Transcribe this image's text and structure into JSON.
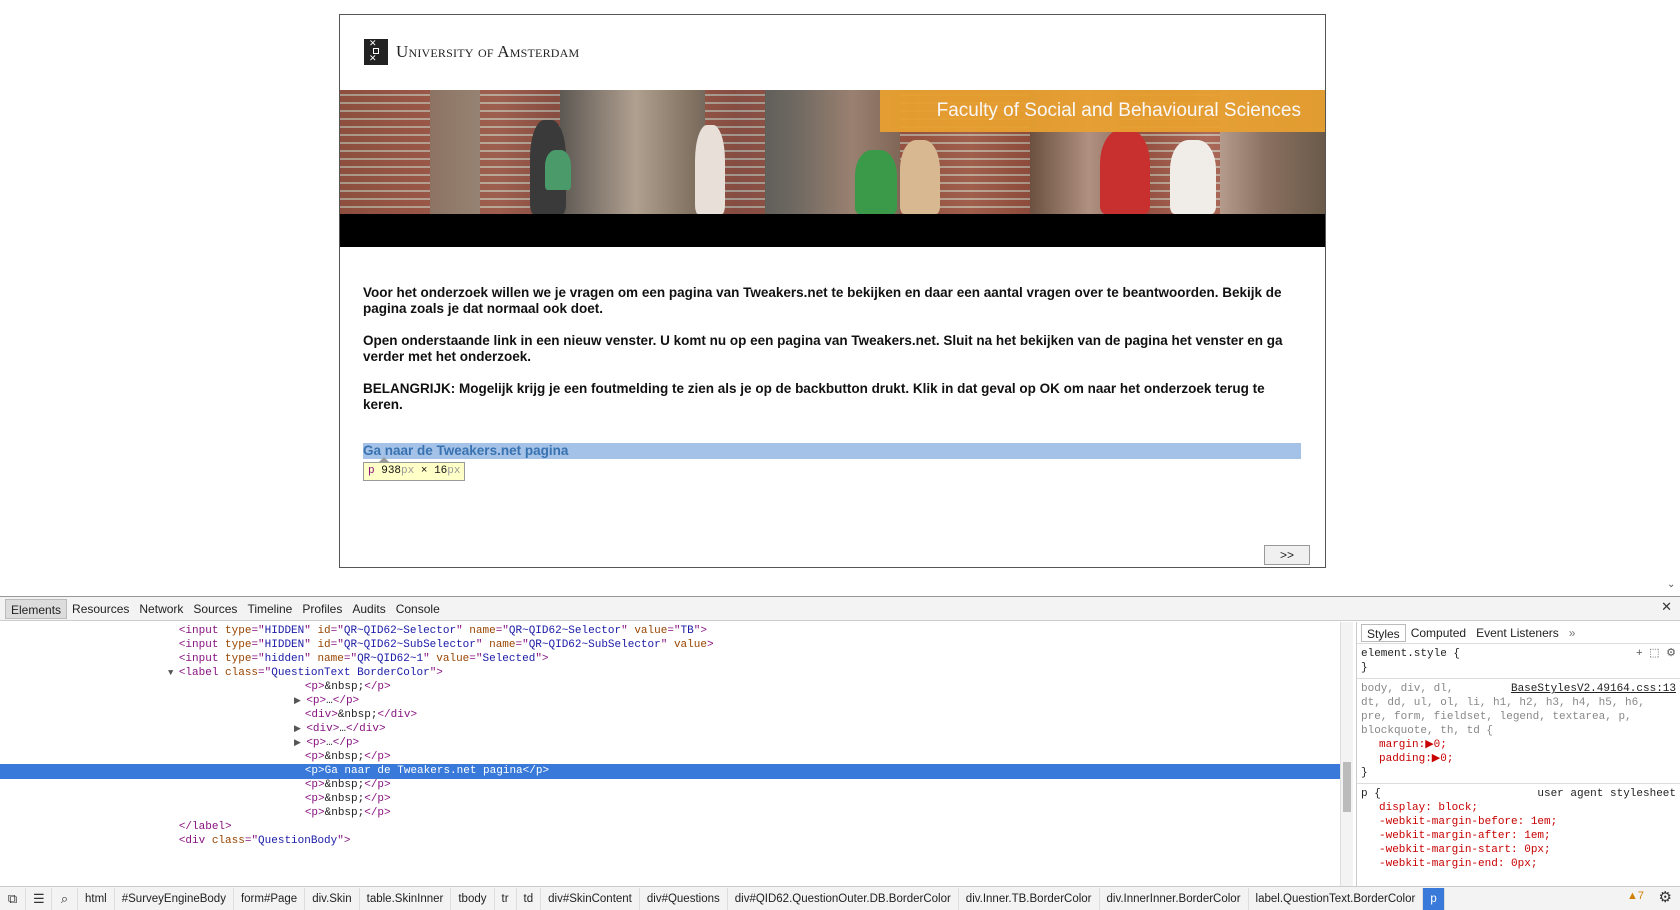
{
  "page": {
    "logo_text": "University of Amsterdam",
    "faculty_title": "Faculty of Social and Behavioural Sciences",
    "paragraphs": [
      "Voor het onderzoek willen we je vragen om een pagina van Tweakers.net te bekijken en daar een aantal vragen over te beantwoorden. Bekijk de pagina zoals je dat normaal ook doet.",
      "Open onderstaande link in een nieuw venster. U komt nu op een pagina van Tweakers.net. Sluit na het bekijken van de pagina het venster en ga verder met het onderzoek.",
      "BELANGRIJK: Mogelijk krijg je een foutmelding te zien als je op de backbutton drukt. Klik in dat geval op OK om naar het onderzoek terug te keren."
    ],
    "link_text": "Ga naar de Tweakers.net pagina",
    "tooltip_tag": "p",
    "tooltip_w": "938",
    "tooltip_h": "16",
    "tooltip_unit": "px",
    "tooltip_x": "×",
    "next_label": ">>"
  },
  "devtools": {
    "tabs": [
      "Elements",
      "Resources",
      "Network",
      "Sources",
      "Timeline",
      "Profiles",
      "Audits",
      "Console"
    ],
    "close": "✕",
    "dom_lines": [
      {
        "indent": 16,
        "html": "<span class='tag'>&lt;input</span> <span class='attr'>type</span>=\"<span class='val'>HIDDEN</span>\" <span class='attr'>id</span>=\"<span class='val'>QR~QID62~Selector</span>\" <span class='attr'>name</span>=\"<span class='val'>QR~QID62~Selector</span>\" <span class='attr'>value</span>=\"<span class='val'>TB</span>\"<span class='tag'>&gt;</span>"
      },
      {
        "indent": 16,
        "html": "<span class='tag'>&lt;input</span> <span class='attr'>type</span>=\"<span class='val'>HIDDEN</span>\" <span class='attr'>id</span>=\"<span class='val'>QR~QID62~SubSelector</span>\" <span class='attr'>name</span>=\"<span class='val'>QR~QID62~SubSelector</span>\" <span class='attr'>value</span><span class='tag'>&gt;</span>"
      },
      {
        "indent": 16,
        "html": "<span class='tag'>&lt;input</span> <span class='attr'>type</span>=\"<span class='val'>hidden</span>\" <span class='attr'>name</span>=\"<span class='val'>QR~QID62~1</span>\" <span class='attr'>value</span>=\"<span class='val'>Selected</span>\"<span class='tag'>&gt;</span>"
      },
      {
        "indent": 16,
        "tri": "▼",
        "html": "<span class='tag'>&lt;label</span> <span class='attr'>class</span>=\"<span class='val'>QuestionText BorderColor</span>\"<span class='tag'>&gt;</span>"
      },
      {
        "indent": 28,
        "html": "<span class='tag'>&lt;p&gt;</span><span class='txt'>&amp;nbsp;</span><span class='tag'>&lt;/p&gt;</span>"
      },
      {
        "indent": 28,
        "tri": "▶",
        "html": "<span class='tag'>&lt;p&gt;</span><span class='txt'>…</span><span class='tag'>&lt;/p&gt;</span>"
      },
      {
        "indent": 28,
        "html": "<span class='tag'>&lt;div&gt;</span><span class='txt'>&amp;nbsp;</span><span class='tag'>&lt;/div&gt;</span>"
      },
      {
        "indent": 28,
        "tri": "▶",
        "html": "<span class='tag'>&lt;div&gt;</span><span class='txt'>…</span><span class='tag'>&lt;/div&gt;</span>"
      },
      {
        "indent": 28,
        "tri": "▶",
        "html": "<span class='tag'>&lt;p&gt;</span><span class='txt'>…</span><span class='tag'>&lt;/p&gt;</span>"
      },
      {
        "indent": 28,
        "html": "<span class='tag'>&lt;p&gt;</span><span class='txt'>&amp;nbsp;</span><span class='tag'>&lt;/p&gt;</span>"
      },
      {
        "indent": 28,
        "selected": true,
        "html": "<span class='tag'>&lt;p&gt;</span><span class='txt'>Ga naar de Tweakers.net pagina</span><span class='tag'>&lt;/p&gt;</span>"
      },
      {
        "indent": 28,
        "html": "<span class='tag'>&lt;p&gt;</span><span class='txt'>&amp;nbsp;</span><span class='tag'>&lt;/p&gt;</span>"
      },
      {
        "indent": 28,
        "html": "<span class='tag'>&lt;p&gt;</span><span class='txt'>&amp;nbsp;</span><span class='tag'>&lt;/p&gt;</span>"
      },
      {
        "indent": 28,
        "html": "<span class='tag'>&lt;p&gt;</span><span class='txt'>&amp;nbsp;</span><span class='tag'>&lt;/p&gt;</span>"
      },
      {
        "indent": 16,
        "html": "<span class='tag'>&lt;/label&gt;</span>"
      },
      {
        "indent": 16,
        "html": "<span class='tag'>&lt;div</span> <span class='attr'>class</span>=\"<span class='val'>QuestionBody</span>\"<span class='tag'>&gt;</span>"
      }
    ],
    "styles_tabs": [
      "Styles",
      "Computed",
      "Event Listeners",
      "»"
    ],
    "element_style": "element.style {",
    "element_style_close": "}",
    "rule1_selector": "body, div, dl,",
    "rule1_selector_rest": "dt, dd, ul, ol, li, h1, h2, h3, h4, h5, h6, pre, form, fieldset, legend, textarea, p, blockquote, th, td {",
    "rule1_source": "BaseStylesV2.49164.css:13",
    "rule1_props": [
      "margin:▶0;",
      "padding:▶0;"
    ],
    "rule2_selector": "p {",
    "rule2_source": "user agent stylesheet",
    "rule2_props": [
      "display: block;",
      "-webkit-margin-before: 1em;",
      "-webkit-margin-after: 1em;",
      "-webkit-margin-start: 0px;",
      "-webkit-margin-end: 0px;"
    ],
    "crumbs": [
      "html",
      "#SurveyEngineBody",
      "form#Page",
      "div.Skin",
      "table.SkinInner",
      "tbody",
      "tr",
      "td",
      "div#SkinContent",
      "div#Questions",
      "div#QID62.QuestionOuter.DB.BorderColor",
      "div.Inner.TB.BorderColor",
      "div.InnerInner.BorderColor",
      "label.QuestionText.BorderColor",
      "p"
    ],
    "warning_count": "▲7"
  }
}
